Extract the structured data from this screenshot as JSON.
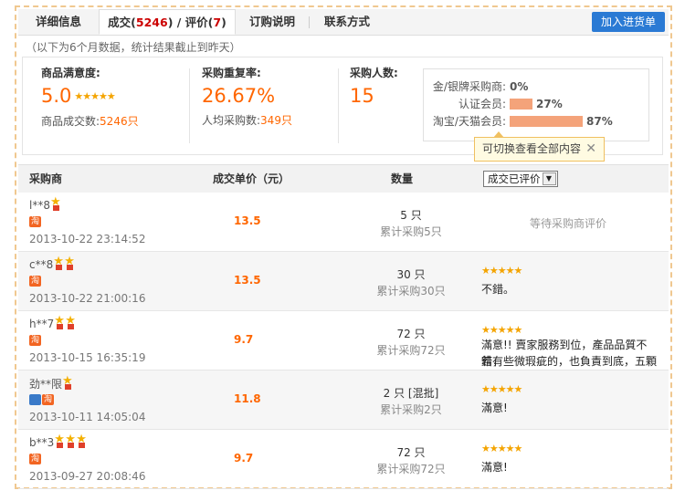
{
  "tabs": {
    "details": "详细信息",
    "deals_prefix": "成交(",
    "deals_count": "5246",
    "deals_mid": ") / 评价(",
    "reviews_count": "7",
    "deals_suffix": ")",
    "ordering": "订购说明",
    "contact": "联系方式",
    "add_button": "加入进货单"
  },
  "note": "（以下为6个月数据，统计结果截止到昨天）",
  "stats": {
    "satisfaction_title": "商品满意度:",
    "satisfaction_value": "5.0",
    "satisfaction_stars": "★★★★★",
    "deals_label": "商品成交数:",
    "deals_value": "5246只",
    "repurchase_title": "采购重复率:",
    "repurchase_value": "26.67%",
    "avg_label": "人均采购数:",
    "avg_value": "349只",
    "buyers_title": "采购人数:",
    "buyers_value": "15"
  },
  "distribution": [
    {
      "label": "金/银牌采购商:",
      "pct": "0%",
      "fraction": 0.0
    },
    {
      "label": "认证会员:",
      "pct": "27%",
      "fraction": 0.27
    },
    {
      "label": "淘宝/天猫会员:",
      "pct": "87%",
      "fraction": 0.87
    }
  ],
  "tooltip": {
    "text": "可切换查看全部内容",
    "close": "✕"
  },
  "table": {
    "col_buyer": "采购商",
    "col_price": "成交单价（元）",
    "col_qty": "数量",
    "filter": "成交已评价",
    "rows": [
      {
        "buyer": "l**8",
        "medals": 1,
        "badges": [
          "tao"
        ],
        "time": "2013-10-22 23:14:52",
        "price": "13.5",
        "qty": "5 只",
        "cum": "累计采购5只",
        "await": "等待采购商评价",
        "stars": "",
        "review": ""
      },
      {
        "buyer": "c**8",
        "medals": 2,
        "badges": [
          "tao"
        ],
        "time": "2013-10-22 21:00:16",
        "price": "13.5",
        "qty": "30 只",
        "cum": "累计采购30只",
        "await": "",
        "stars": "★★★★★",
        "review": "不錯。"
      },
      {
        "buyer": "h**7",
        "medals": 2,
        "badges": [
          "tao"
        ],
        "time": "2013-10-15 16:35:19",
        "price": "9.7",
        "qty": "72 只",
        "cum": "累计采购72只",
        "await": "",
        "stars": "★★★★★",
        "review": "滿意!! 賣家服務到位，產品品質不錯，",
        "review2": "若有些微瑕疵的，也負責到底，五顆星!!"
      },
      {
        "buyer": "劲**限",
        "medals": 1,
        "badges": [
          "b",
          "tao"
        ],
        "time": "2013-10-11 14:05:04",
        "price": "11.8",
        "qty": "2 只 [混批]",
        "cum": "累计采购2只",
        "await": "",
        "stars": "★★★★★",
        "review": "滿意!"
      },
      {
        "buyer": "b**3",
        "medals": 3,
        "badges": [
          "tao"
        ],
        "time": "2013-09-27 20:08:46",
        "price": "9.7",
        "qty": "72 只",
        "cum": "累计采购72只",
        "await": "",
        "stars": "★★★★★",
        "review": "滿意!"
      }
    ]
  },
  "colors": {
    "accent": "#ff6600",
    "button": "#2a7ad4",
    "bar": "#f4a37a",
    "star": "#f4a400"
  }
}
